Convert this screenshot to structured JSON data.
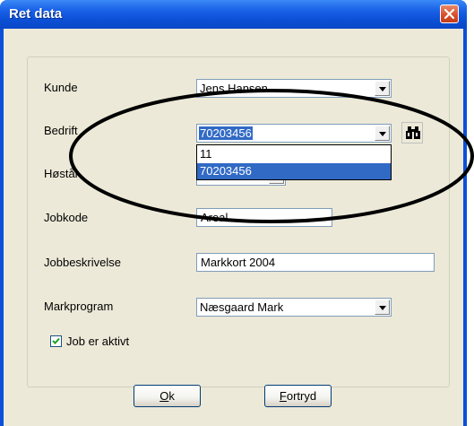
{
  "window": {
    "title": "Ret data"
  },
  "fields": {
    "kunde": {
      "label": "Kunde",
      "value": "Jens Hansen"
    },
    "bedrift": {
      "label": "Bedrift",
      "value": "70203456"
    },
    "hoestaar": {
      "label": "Høstår"
    },
    "jobkode": {
      "label": "Jobkode",
      "value": "Areal"
    },
    "jobbeskrivelse": {
      "label": "Jobbeskrivelse",
      "value": "Markkort 2004"
    },
    "markprogram": {
      "label": "Markprogram",
      "value": "Næsgaard Mark"
    }
  },
  "bedrift_dropdown": {
    "options": [
      "11",
      "70203456"
    ],
    "selected": "70203456"
  },
  "checkbox": {
    "label": "Job er aktivt",
    "checked": true
  },
  "buttons": {
    "ok": {
      "mnemonic": "O",
      "rest": "k"
    },
    "cancel": {
      "mnemonic": "F",
      "rest": "ortryd"
    }
  },
  "icons": {
    "close": "close-icon",
    "find": "binoculars-icon",
    "check": "checkmark-icon"
  },
  "colors": {
    "titlebar": "#0a50d8",
    "close_button": "#d9512c",
    "selection": "#316ac5",
    "dialog_background": "#ece9d8"
  }
}
